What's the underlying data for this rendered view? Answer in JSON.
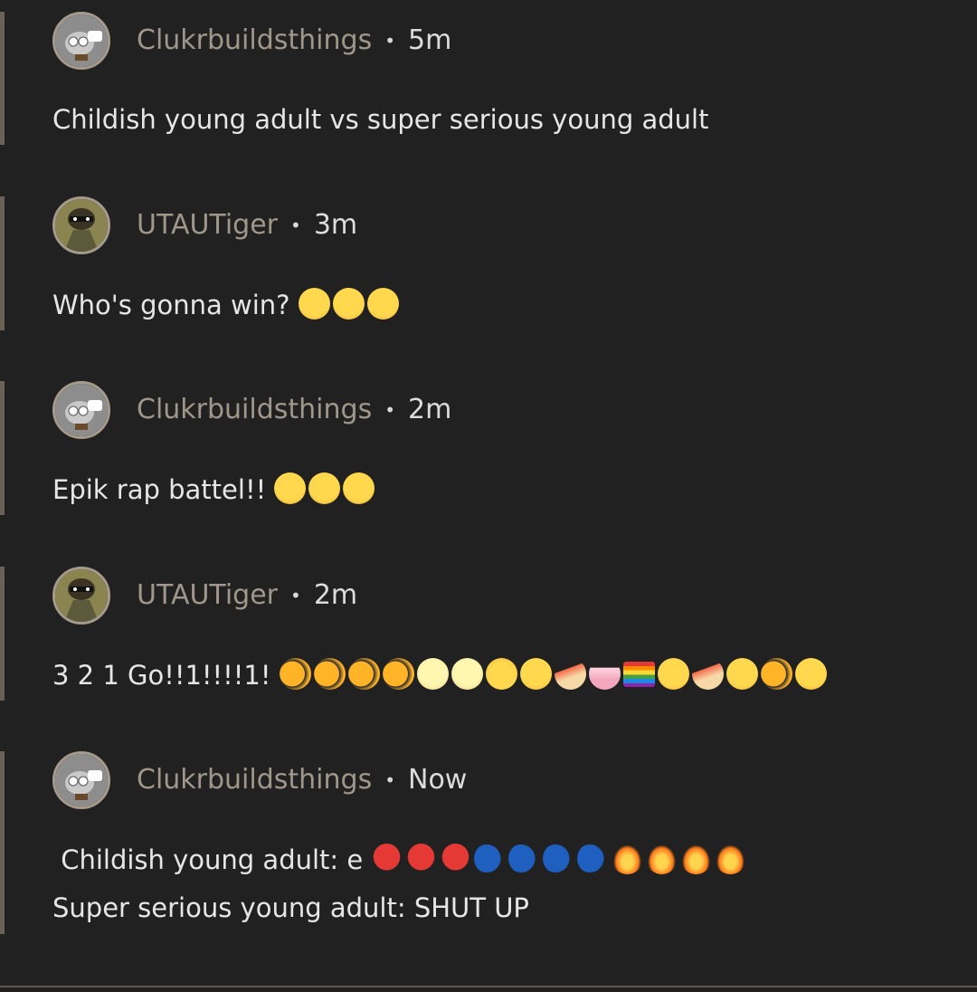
{
  "comments": [
    {
      "username": "Clukrbuildsthings",
      "separator": "•",
      "time": "5m",
      "lines": [
        {
          "text": "Childish young adult vs super serious young adult",
          "emojis": []
        }
      ]
    },
    {
      "username": "UTAUTiger",
      "separator": "•",
      "time": "3m",
      "lines": [
        {
          "text": "Who's gonna win?",
          "emojis": [
            "😱",
            "😱",
            "😱"
          ]
        }
      ]
    },
    {
      "username": "Clukrbuildsthings",
      "separator": "•",
      "time": "2m",
      "lines": [
        {
          "text": "Epik rap battel!!",
          "emojis": [
            "🤑",
            "🤑",
            "🤑"
          ]
        }
      ]
    },
    {
      "username": "UTAUTiger",
      "separator": "•",
      "time": "2m",
      "lines": [
        {
          "text": "3 2 1 Go!!1!!!!1!",
          "emojis": [
            "🐠",
            "🐠",
            "🐠",
            "🐠",
            "🌝",
            "🌝",
            "😇",
            "😮",
            "🍰",
            "🎂",
            "🏳️‍🌈",
            "😲",
            "🍰",
            "😮",
            "🐠",
            "😲"
          ]
        }
      ]
    },
    {
      "username": "Clukrbuildsthings",
      "separator": "•",
      "time": "Now",
      "lines": [
        {
          "text": " Childish young adult: e",
          "emojis": [
            "💔",
            "💔",
            "💔",
            "🗣️",
            "🗣️",
            "🗣️",
            "🗣️",
            "🔥",
            "🔥",
            "🔥",
            "🔥"
          ]
        },
        {
          "text": "Super serious young adult: SHUT UP",
          "emojis": []
        }
      ]
    }
  ],
  "colors": {
    "background": "#212121",
    "username": "#a0978a",
    "text": "#e6e6e6",
    "rail": "#6b6257"
  }
}
